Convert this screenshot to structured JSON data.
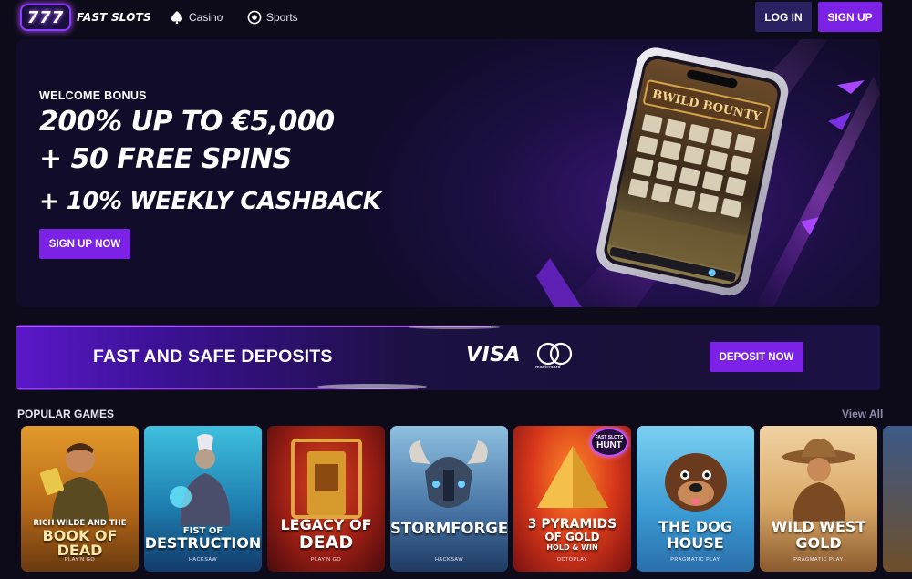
{
  "header": {
    "logo_mark": "777",
    "logo_text": "FAST SLOTS",
    "nav": [
      {
        "label": "Casino",
        "icon": "spade-icon"
      },
      {
        "label": "Sports",
        "icon": "soccer-ball-icon"
      }
    ],
    "login_label": "LOG IN",
    "signup_label": "SIGN UP"
  },
  "hero": {
    "eyebrow": "WELCOME BONUS",
    "line1": "200% UP TO €5,000",
    "line2": "+ 50 FREE SPINS",
    "line3": "+ 10% WEEKLY CASHBACK",
    "cta_label": "SIGN UP NOW",
    "phone_game_title": "BWILD BOUNTY"
  },
  "deposit": {
    "title": "FAST AND SAFE DEPOSITS",
    "visa_label": "VISA",
    "mastercard_label": "mastercard",
    "cta_label": "DEPOSIT NOW"
  },
  "popular": {
    "title": "POPULAR GAMES",
    "view_all_label": "View All",
    "games": [
      {
        "title_top": "RICH WILDE AND THE",
        "title_main": "BOOK OF DEAD",
        "provider": "PLAY'N GO",
        "colors": [
          "#d88a1e",
          "#8a4a10"
        ]
      },
      {
        "title_top": "FIST OF",
        "title_main": "DESTRUCTION",
        "provider": "HACKSAW",
        "colors": [
          "#2aa7c8",
          "#145a86"
        ]
      },
      {
        "title_top": "LEGACY OF",
        "title_main": "DEAD",
        "provider": "PLAY'N GO",
        "colors": [
          "#c92f1f",
          "#6a0f10"
        ]
      },
      {
        "title_top": "",
        "title_main": "STORMFORGED",
        "provider": "HACKSAW",
        "colors": [
          "#6fa6cf",
          "#2a4e79"
        ]
      },
      {
        "title_top": "3 PYRAMIDS",
        "title_main": "OF GOLD",
        "title_sub": "HOLD & WIN",
        "provider": "OCTOPLAY",
        "colors": [
          "#e0521e",
          "#8e1e10"
        ],
        "badge_small": "FAST SLOTS",
        "badge_big": "HUNT"
      },
      {
        "title_top": "THE DOG",
        "title_main": "HOUSE",
        "provider": "PRAGMATIC PLAY",
        "colors": [
          "#5fbfe8",
          "#2b7fb8"
        ]
      },
      {
        "title_top": "WILD WEST",
        "title_main": "GOLD",
        "provider": "PRAGMATIC PLAY",
        "colors": [
          "#e7c08a",
          "#8a5a2e"
        ]
      }
    ]
  }
}
